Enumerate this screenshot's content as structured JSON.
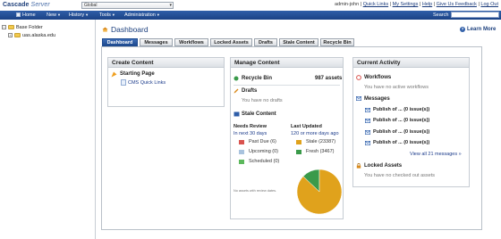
{
  "app": {
    "logo_bold": "Cascade",
    "logo_light": "Server",
    "site_select": "Global"
  },
  "userbar": {
    "user": "admin-john",
    "sep1": "|",
    "quick_links": "Quick Links",
    "sep2": "|",
    "my_settings": "My Settings",
    "sep3": "|",
    "help": "Help",
    "sep4": "|",
    "feedback": "Give Us Feedback",
    "sep5": "|",
    "logout": "Log Out"
  },
  "nav": {
    "home": "Home",
    "new": "New",
    "history": "History",
    "tools": "Tools",
    "administration": "Administration",
    "search_label": "Search"
  },
  "tree": {
    "items": [
      {
        "label": "Base Folder",
        "toggle": "−"
      },
      {
        "label": "uas.alaska.edu",
        "toggle": "+"
      }
    ]
  },
  "page": {
    "title": "Dashboard",
    "learn_more": "Learn More"
  },
  "tabs": [
    "Dashboard",
    "Messages",
    "Workflows",
    "Locked Assets",
    "Drafts",
    "Stale Content",
    "Recycle Bin"
  ],
  "create_content": {
    "title": "Create Content",
    "starting_page": "Starting Page",
    "quick_link": "CMS Quick Links"
  },
  "manage_content": {
    "title": "Manage Content",
    "recycle_bin": "Recycle Bin",
    "recycle_count": "987 assets",
    "drafts": "Drafts",
    "drafts_empty": "You have no drafts",
    "stale_title": "Stale Content",
    "needs_review": "Needs Review",
    "needs_review_sub": "In next 30 days",
    "last_updated": "Last Updated",
    "last_updated_sub": "120 or more days ago",
    "past_due": "Past Due (6)",
    "upcoming": "Upcoming (0)",
    "scheduled": "Scheduled (0)",
    "stale": "Stale (23387)",
    "fresh": "Fresh (3467)",
    "no_review_note": "No assets with review dates."
  },
  "current_activity": {
    "title": "Current Activity",
    "workflows": "Workflows",
    "workflows_empty": "You have no active workflows",
    "messages": "Messages",
    "message_items": [
      "Publish of ... (0 issue(s))",
      "Publish of ... (0 issue(s))",
      "Publish of ... (0 issue(s))",
      "Publish of ... (0 issue(s))"
    ],
    "view_all": "View all 21 messages »",
    "locked_assets": "Locked Assets",
    "locked_empty": "You have no checked out assets"
  },
  "colors": {
    "past_due": "#d9534f",
    "upcoming": "#a9c3de",
    "scheduled": "#5cb85c",
    "stale": "#e0a21c",
    "fresh": "#3a9a4a"
  },
  "chart_data": {
    "type": "pie",
    "categories": [
      "Stale",
      "Fresh"
    ],
    "values": [
      23387,
      3467
    ]
  }
}
